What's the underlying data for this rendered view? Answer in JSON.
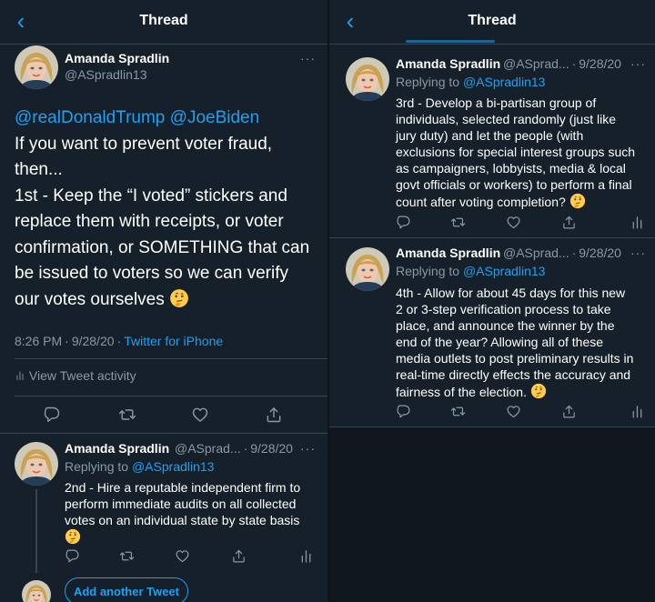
{
  "left": {
    "header": {
      "title": "Thread",
      "back_icon": "chevron-left-icon"
    },
    "main_tweet": {
      "author_name": "Amanda Spradlin",
      "author_handle": "@ASpradlin13",
      "mention_1": "@realDonaldTrump",
      "mention_2": "@JoeBiden",
      "lines": [
        "If you want to prevent voter fraud,",
        "then...",
        "1st - Keep the “I voted” stickers and",
        "replace them with receipts, or voter",
        "confirmation, or SOMETHING that can",
        "be issued to voters so we can verify",
        "our votes ourselves"
      ],
      "time": "8:26 PM",
      "date": "9/28/20",
      "source": "Twitter for iPhone",
      "activity_label": "View Tweet activity"
    },
    "reply_tweet": {
      "author_name": "Amanda Spradlin",
      "author_handle": "@ASprad...",
      "date": "9/28/20",
      "replying_label": "Replying to",
      "replying_handle": "@ASpradlin13",
      "lines": [
        "2nd - Hire a reputable independent firm to",
        "perform immediate audits on all collected",
        "votes on an individual state by state basis"
      ]
    },
    "add_tweet_label": "Add another Tweet"
  },
  "right": {
    "header": {
      "title": "Thread",
      "back_icon": "chevron-left-icon"
    },
    "tweet_3": {
      "author_name": "Amanda Spradlin",
      "author_handle": "@ASprad...",
      "date": "9/28/20",
      "replying_label": "Replying to",
      "replying_handle": "@ASpradlin13",
      "lines": [
        "3rd - Develop a bi-partisan group of",
        "individuals, selected randomly (just like",
        "jury duty) and let the people (with",
        "exclusions for special interest groups such",
        "as campaigners, lobbyists, media & local",
        "govt officials or workers) to perform a final",
        "count after voting completion?"
      ]
    },
    "tweet_4": {
      "author_name": "Amanda Spradlin",
      "author_handle": "@ASprad...",
      "date": "9/28/20",
      "replying_label": "Replying to",
      "replying_handle": "@ASpradlin13",
      "lines": [
        "4th - Allow for about 45 days for this new",
        "2 or 3-step verification process to take",
        "place, and announce the winner by the",
        "end of the year? Allowing all of these",
        "media outlets to post preliminary results in",
        "real-time directly effects the accuracy and",
        "fairness of the election."
      ]
    }
  },
  "common": {
    "separator_dot": "·",
    "more_label": "···",
    "emoji": "thinking-face",
    "icons": [
      "reply-icon",
      "retweet-icon",
      "like-icon",
      "share-icon",
      "analytics-icon"
    ]
  },
  "colors": {
    "background": "#15202b",
    "accent": "#1da1f2",
    "secondary_text": "#8899a6",
    "border": "#38444d"
  }
}
